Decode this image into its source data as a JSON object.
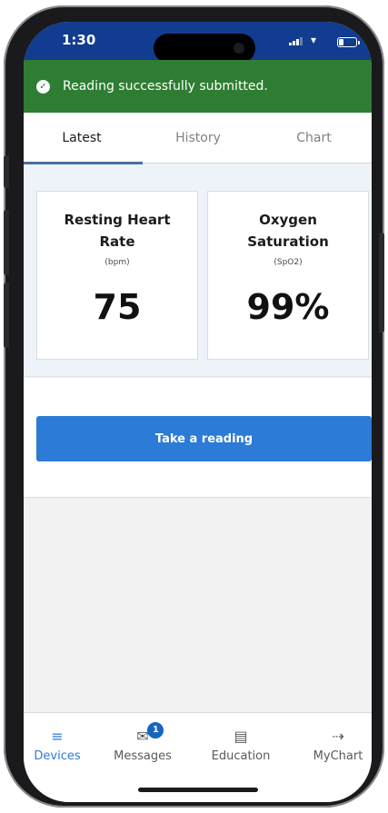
{
  "status_bar": {
    "time": "1:30",
    "battery_level": 0.3
  },
  "banner": {
    "icon": "check-circle-icon",
    "message": "Reading successfully submitted.",
    "color": "#2e7d32"
  },
  "tabs": [
    {
      "label": "Latest",
      "active": true
    },
    {
      "label": "History",
      "active": false
    },
    {
      "label": "Chart",
      "active": false
    }
  ],
  "cards": [
    {
      "title_line1": "Resting Heart",
      "title_line2": "Rate",
      "unit": "(bpm)",
      "value": "75"
    },
    {
      "title_line1": "Oxygen",
      "title_line2": "Saturation",
      "unit": "(SpO2)",
      "value": "99%"
    }
  ],
  "action": {
    "button_label": "Take a reading",
    "color": "#2c7bd7"
  },
  "bottom_nav": [
    {
      "label": "Devices",
      "icon": "list-icon",
      "active": true
    },
    {
      "label": "Messages",
      "icon": "envelope-icon",
      "badge": "1",
      "active": false
    },
    {
      "label": "Education",
      "icon": "book-icon",
      "active": false
    },
    {
      "label": "MyChart",
      "icon": "sign-in-icon",
      "active": false
    }
  ],
  "colors": {
    "header_blue": "#113c8f",
    "accent": "#2c7bd7"
  }
}
